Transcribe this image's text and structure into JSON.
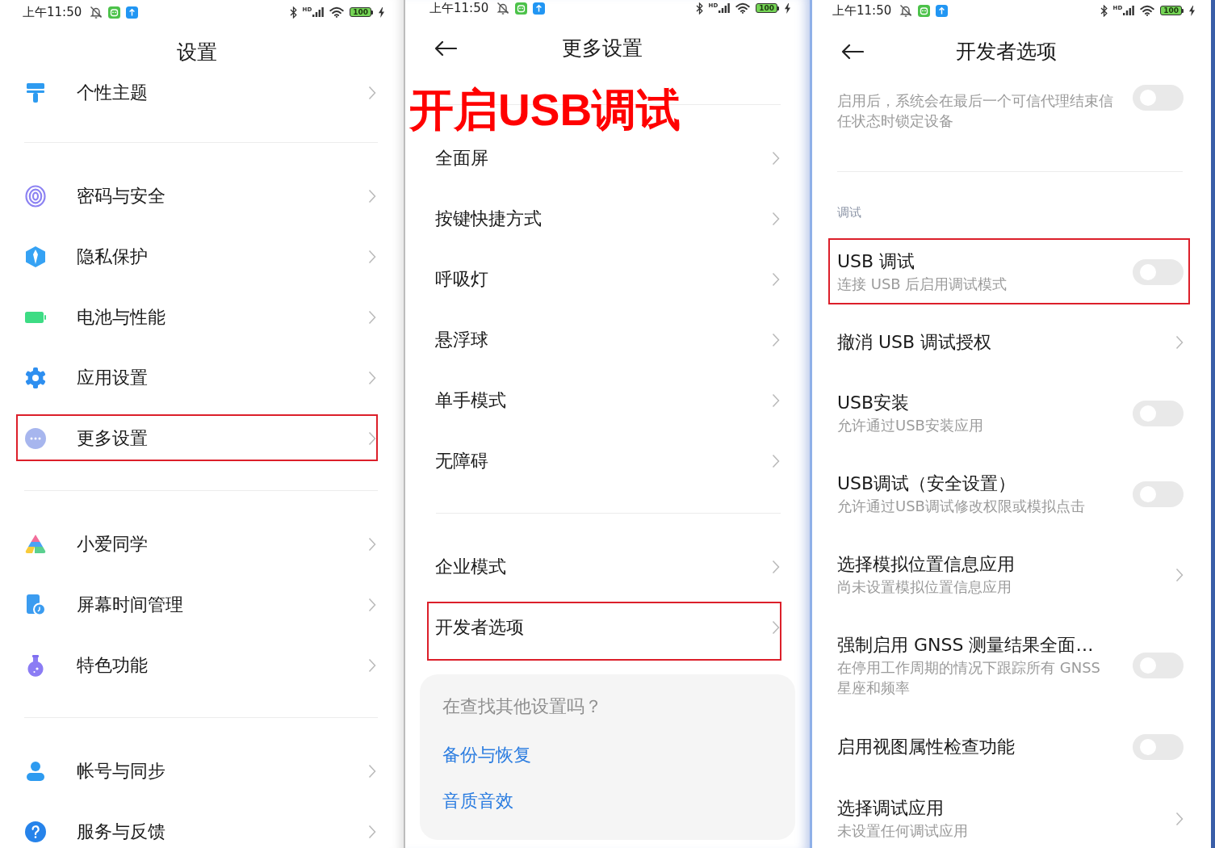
{
  "screens": [
    {
      "status_bar": {
        "time": "上午11:50",
        "network_label": "HD",
        "battery": "100"
      },
      "back_button": false,
      "title": "设置",
      "groups": [
        {
          "items": [
            {
              "kind": "link",
              "label": "个性主题",
              "highlighted": false
            }
          ]
        },
        {
          "items": [
            {
              "kind": "link",
              "label": "密码与安全",
              "highlighted": false
            },
            {
              "kind": "link",
              "label": "隐私保护",
              "highlighted": false
            },
            {
              "kind": "link",
              "label": "电池与性能",
              "highlighted": false
            },
            {
              "kind": "link",
              "label": "应用设置",
              "highlighted": false
            },
            {
              "kind": "link",
              "label": "更多设置",
              "highlighted": true
            }
          ]
        },
        {
          "items": [
            {
              "kind": "link",
              "label": "小爱同学",
              "highlighted": false
            },
            {
              "kind": "link",
              "label": "屏幕时间管理",
              "highlighted": false
            },
            {
              "kind": "link",
              "label": "特色功能",
              "highlighted": false
            }
          ]
        },
        {
          "items": [
            {
              "kind": "link",
              "label": "帐号与同步",
              "highlighted": false
            },
            {
              "kind": "link",
              "label": "服务与反馈",
              "highlighted": false
            }
          ]
        }
      ]
    },
    {
      "status_bar": {
        "time": "上午11:50",
        "network_label": "HD",
        "battery": "100"
      },
      "back_button": true,
      "title": "更多设置",
      "annotation": "开启USB调试",
      "groups": [
        {
          "items": [
            {
              "kind": "link",
              "label": "全面屏",
              "highlighted": false
            },
            {
              "kind": "link",
              "label": "按键快捷方式",
              "highlighted": false
            },
            {
              "kind": "link",
              "label": "呼吸灯",
              "highlighted": false
            },
            {
              "kind": "link",
              "label": "悬浮球",
              "highlighted": false
            },
            {
              "kind": "link",
              "label": "单手模式",
              "highlighted": false
            },
            {
              "kind": "link",
              "label": "无障碍",
              "highlighted": false
            }
          ]
        },
        {
          "items": [
            {
              "kind": "link",
              "label": "企业模式",
              "highlighted": false
            },
            {
              "kind": "link",
              "label": "开发者选项",
              "highlighted": true
            }
          ]
        }
      ],
      "suggestions": {
        "prompt": "在查找其他设置吗？",
        "links": [
          "备份与恢复",
          "音质音效"
        ]
      }
    },
    {
      "status_bar": {
        "time": "上午11:50",
        "network_label": "HD",
        "battery": "100"
      },
      "back_button": true,
      "title": "开发者选项",
      "groups": [
        {
          "items": [
            {
              "kind": "toggle",
              "description": "启用后，系统会在最后一个可信代理结束信任状态时锁定设备",
              "on": false,
              "highlighted": false
            }
          ]
        },
        {
          "header": "调试",
          "items": [
            {
              "kind": "toggle",
              "label": "USB 调试",
              "description": "连接 USB 后启用调试模式",
              "on": false,
              "highlighted": true
            },
            {
              "kind": "link",
              "label": "撤消 USB 调试授权",
              "highlighted": false
            },
            {
              "kind": "toggle",
              "label": "USB安装",
              "description": "允许通过USB安装应用",
              "on": false,
              "highlighted": false
            },
            {
              "kind": "toggle",
              "label": "USB调试（安全设置）",
              "description": "允许通过USB调试修改权限或模拟点击",
              "on": false,
              "highlighted": false
            },
            {
              "kind": "link",
              "label": "选择模拟位置信息应用",
              "description": "尚未设置模拟位置信息应用",
              "highlighted": false
            },
            {
              "kind": "toggle",
              "label": "强制启用 GNSS 测量结果全面…",
              "description": "在停用工作周期的情况下跟踪所有 GNSS 星座和频率",
              "on": false,
              "highlighted": false
            },
            {
              "kind": "toggle",
              "label": "启用视图属性检查功能",
              "on": false,
              "highlighted": false
            },
            {
              "kind": "link",
              "label": "选择调试应用",
              "description": "未设置任何调试应用",
              "highlighted": false
            }
          ]
        }
      ]
    }
  ]
}
